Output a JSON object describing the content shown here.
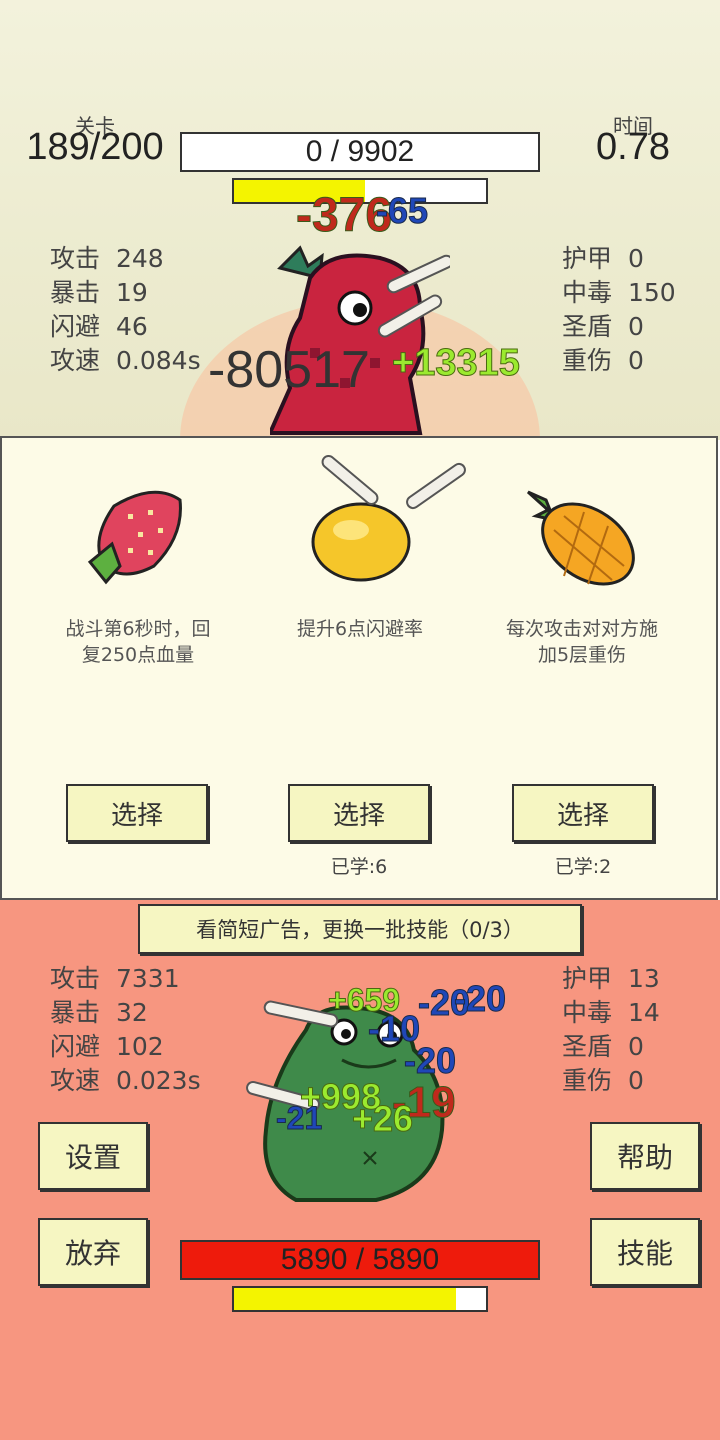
{
  "header": {
    "level_label": "关卡",
    "level_value": "189/200",
    "time_label": "时间",
    "time_value": "0.78",
    "enemy_hp_text": "0 / 9902",
    "enemy_energy_fraction": 0.52
  },
  "enemy": {
    "icon": "red-dragon-icon",
    "stats_left": [
      {
        "label": "攻击",
        "value": "248"
      },
      {
        "label": "暴击",
        "value": "19"
      },
      {
        "label": "闪避",
        "value": "46"
      },
      {
        "label": "攻速",
        "value": "0.084s"
      }
    ],
    "stats_right": [
      {
        "label": "护甲",
        "value": "0"
      },
      {
        "label": "中毒",
        "value": "150"
      },
      {
        "label": "圣盾",
        "value": "0"
      },
      {
        "label": "重伤",
        "value": "0"
      }
    ],
    "floating_numbers": [
      "-376",
      "-65",
      "-80517",
      "+13315"
    ]
  },
  "skills": [
    {
      "icon": "strawberry-icon",
      "desc_line1": "战斗第6秒时，回",
      "desc_line2": "复250点血量",
      "button": "选择",
      "learned": ""
    },
    {
      "icon": "lemon-icon",
      "desc_line1": "提升6点闪避率",
      "desc_line2": "",
      "button": "选择",
      "learned": "已学:6"
    },
    {
      "icon": "pineapple-icon",
      "desc_line1": "每次攻击对对方施",
      "desc_line2": "加5层重伤",
      "button": "选择",
      "learned": "已学:2"
    }
  ],
  "ad_button": "看简短广告，更换一批技能（0/3）",
  "player": {
    "icon": "green-frog-icon",
    "stats_left": [
      {
        "label": "攻击",
        "value": "7331"
      },
      {
        "label": "暴击",
        "value": "32"
      },
      {
        "label": "闪避",
        "value": "102"
      },
      {
        "label": "攻速",
        "value": "0.023s"
      }
    ],
    "stats_right": [
      {
        "label": "护甲",
        "value": "13"
      },
      {
        "label": "中毒",
        "value": "14"
      },
      {
        "label": "圣盾",
        "value": "0"
      },
      {
        "label": "重伤",
        "value": "0"
      }
    ],
    "floating_numbers": [
      "+659",
      "-20",
      "-20",
      "-10",
      "-20",
      "+998",
      "-19",
      "-21",
      "+26"
    ],
    "hp_text": "5890 / 5890",
    "energy_fraction": 0.88
  },
  "buttons": {
    "settings": "设置",
    "help": "帮助",
    "give_up": "放弃",
    "skills": "技能"
  },
  "colors": {
    "top_bg": "#f3f2dc",
    "bottom_bg": "#f79680",
    "energy_yellow": "#f4f400",
    "hp_red": "#ee1b0c",
    "button_bg": "#f6f6c2"
  }
}
